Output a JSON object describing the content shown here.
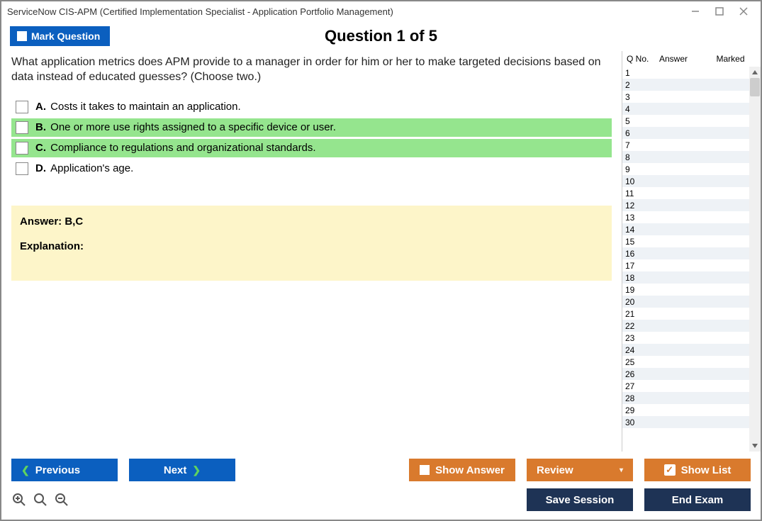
{
  "window": {
    "title": "ServiceNow CIS-APM (Certified Implementation Specialist - Application Portfolio Management)"
  },
  "header": {
    "mark_label": "Mark Question",
    "question_label": "Question 1 of 5"
  },
  "question": {
    "text": "What application metrics does APM provide to a manager in order for him or her to make targeted decisions based on data instead of educated guesses? (Choose two.)",
    "choices": [
      {
        "letter": "A.",
        "text": "Costs it takes to maintain an application.",
        "highlight": false
      },
      {
        "letter": "B.",
        "text": "One or more use rights assigned to a specific device or user.",
        "highlight": true
      },
      {
        "letter": "C.",
        "text": "Compliance to regulations and organizational standards.",
        "highlight": true
      },
      {
        "letter": "D.",
        "text": "Application's age.",
        "highlight": false
      }
    ]
  },
  "answer": {
    "line": "Answer: B,C",
    "explanation_label": "Explanation:"
  },
  "sidebar": {
    "headers": {
      "qno": "Q No.",
      "answer": "Answer",
      "marked": "Marked"
    },
    "rows": [
      1,
      2,
      3,
      4,
      5,
      6,
      7,
      8,
      9,
      10,
      11,
      12,
      13,
      14,
      15,
      16,
      17,
      18,
      19,
      20,
      21,
      22,
      23,
      24,
      25,
      26,
      27,
      28,
      29,
      30
    ]
  },
  "footer": {
    "previous": "Previous",
    "next": "Next",
    "show_answer": "Show Answer",
    "review": "Review",
    "show_list": "Show List",
    "save_session": "Save Session",
    "end_exam": "End Exam"
  }
}
